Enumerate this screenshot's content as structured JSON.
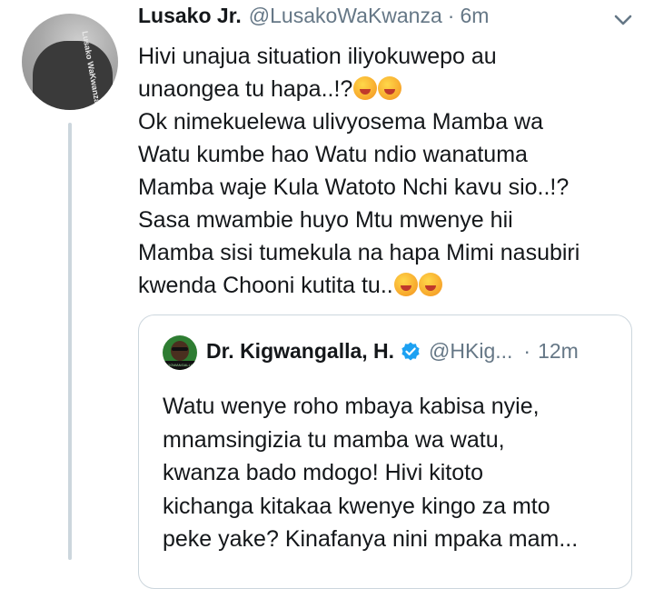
{
  "tweet": {
    "author_name": "Lusako Jr.",
    "author_handle": "@LusakoWaKwanza",
    "separator": "·",
    "timestamp": "6m",
    "avatar_shirt_text": "Lusako WaKwanza",
    "text_lines": [
      "Hivi unajua situation iliyokuwepo au",
      "unaongea tu hapa..!?",
      "Ok nimekuelewa ulivyosema Mamba wa",
      "Watu kumbe hao Watu ndio wanatuma",
      "Mamba waje Kula Watoto Nchi kavu sio..!?",
      "Sasa mwambie huyo Mtu mwenye hii",
      "Mamba sisi tumekula na hapa Mimi nasubiri",
      "kwenda Chooni kutita tu.."
    ],
    "emojis": [
      "rofl-emoji",
      "laughing-emoji"
    ]
  },
  "quote": {
    "author_name": "Dr. Kigwangalla, H.",
    "author_handle": "@HKig...",
    "separator": "·",
    "timestamp": "12m",
    "avatar_text": "KIGWANGALLA",
    "text_lines": [
      "Watu wenye roho mbaya kabisa nyie,",
      "mnamsingizia tu mamba wa watu,",
      "kwanza bado mdogo! Hivi kitoto",
      "kichanga kitakaa kwenye kingo za mto",
      "peke yake? Kinafanya nini mpaka mam..."
    ]
  },
  "colors": {
    "primary_text": "#14171a",
    "secondary_text": "#657786",
    "border": "#ccd6dd",
    "verified_blue": "#1da1f2"
  },
  "icons": {
    "menu": "chevron-down-icon",
    "verified": "verified-badge-icon"
  }
}
